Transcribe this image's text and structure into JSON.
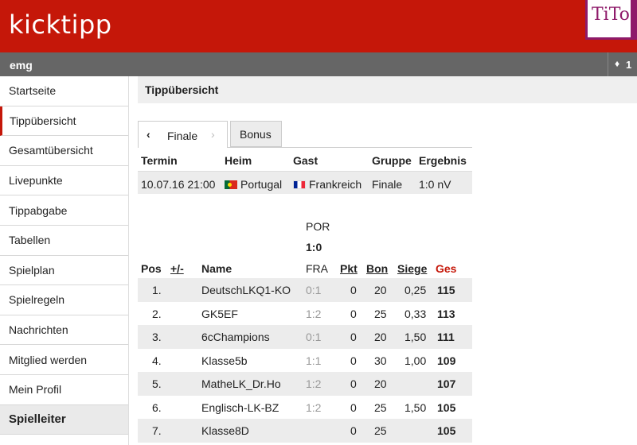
{
  "app": {
    "logo": "kicktipp",
    "partner_logo": "TiTo"
  },
  "group": {
    "name": "emg",
    "right_icon": "bell-icon",
    "right_count": "1"
  },
  "nav": [
    {
      "label": "Startseite",
      "active": false
    },
    {
      "label": "Tippübersicht",
      "active": true
    },
    {
      "label": "Gesamtübersicht",
      "active": false
    },
    {
      "label": "Livepunkte",
      "active": false
    },
    {
      "label": "Tippabgabe",
      "active": false
    },
    {
      "label": "Tabellen",
      "active": false
    },
    {
      "label": "Spielplan",
      "active": false
    },
    {
      "label": "Spielregeln",
      "active": false
    },
    {
      "label": "Nachrichten",
      "active": false
    },
    {
      "label": "Mitglied werden",
      "active": false
    },
    {
      "label": "Mein Profil",
      "active": false
    },
    {
      "label": "Spielleiter",
      "active": false,
      "section": true
    }
  ],
  "page": {
    "title": "Tippübersicht"
  },
  "tabs": {
    "round_label": "Finale",
    "prev_icon": "‹",
    "next_icon": "›",
    "bonus_label": "Bonus"
  },
  "match": {
    "headers": {
      "termin": "Termin",
      "heim": "Heim",
      "gast": "Gast",
      "gruppe": "Gruppe",
      "ergebnis": "Ergebnis"
    },
    "row": {
      "termin": "10.07.16 21:00",
      "heim": "Portugal",
      "gast": "Frankreich",
      "gruppe": "Finale",
      "ergebnis": "1:0 nV"
    }
  },
  "standings": {
    "headers": {
      "pos": "Pos",
      "change": "+/-",
      "name": "Name",
      "match_home": "POR",
      "match_score": "1:0",
      "match_away": "FRA",
      "pkt": "Pkt",
      "bon": "Bon",
      "siege": "Siege",
      "ges": "Ges"
    },
    "rows": [
      {
        "pos": "1.",
        "name": "DeutschLKQ1-KO",
        "tip": "0:1",
        "pkt": "0",
        "bon": "20",
        "siege": "0,25",
        "ges": "115"
      },
      {
        "pos": "2.",
        "name": "GK5EF",
        "tip": "1:2",
        "pkt": "0",
        "bon": "25",
        "siege": "0,33",
        "ges": "113"
      },
      {
        "pos": "3.",
        "name": "6cChampions",
        "tip": "0:1",
        "pkt": "0",
        "bon": "20",
        "siege": "1,50",
        "ges": "111"
      },
      {
        "pos": "4.",
        "name": "Klasse5b",
        "tip": "1:1",
        "pkt": "0",
        "bon": "30",
        "siege": "1,00",
        "ges": "109"
      },
      {
        "pos": "5.",
        "name": "MatheLK_Dr.Ho",
        "tip": "1:2",
        "pkt": "0",
        "bon": "20",
        "siege": "",
        "ges": "107"
      },
      {
        "pos": "6.",
        "name": "Englisch-LK-BZ",
        "tip": "1:2",
        "pkt": "0",
        "bon": "25",
        "siege": "1,50",
        "ges": "105"
      },
      {
        "pos": "7.",
        "name": "Klasse8D",
        "tip": "",
        "pkt": "0",
        "bon": "25",
        "siege": "",
        "ges": "105"
      }
    ]
  },
  "colors": {
    "brand": "#c51709",
    "groupbar": "#666666",
    "partner": "#8e1a6a"
  }
}
